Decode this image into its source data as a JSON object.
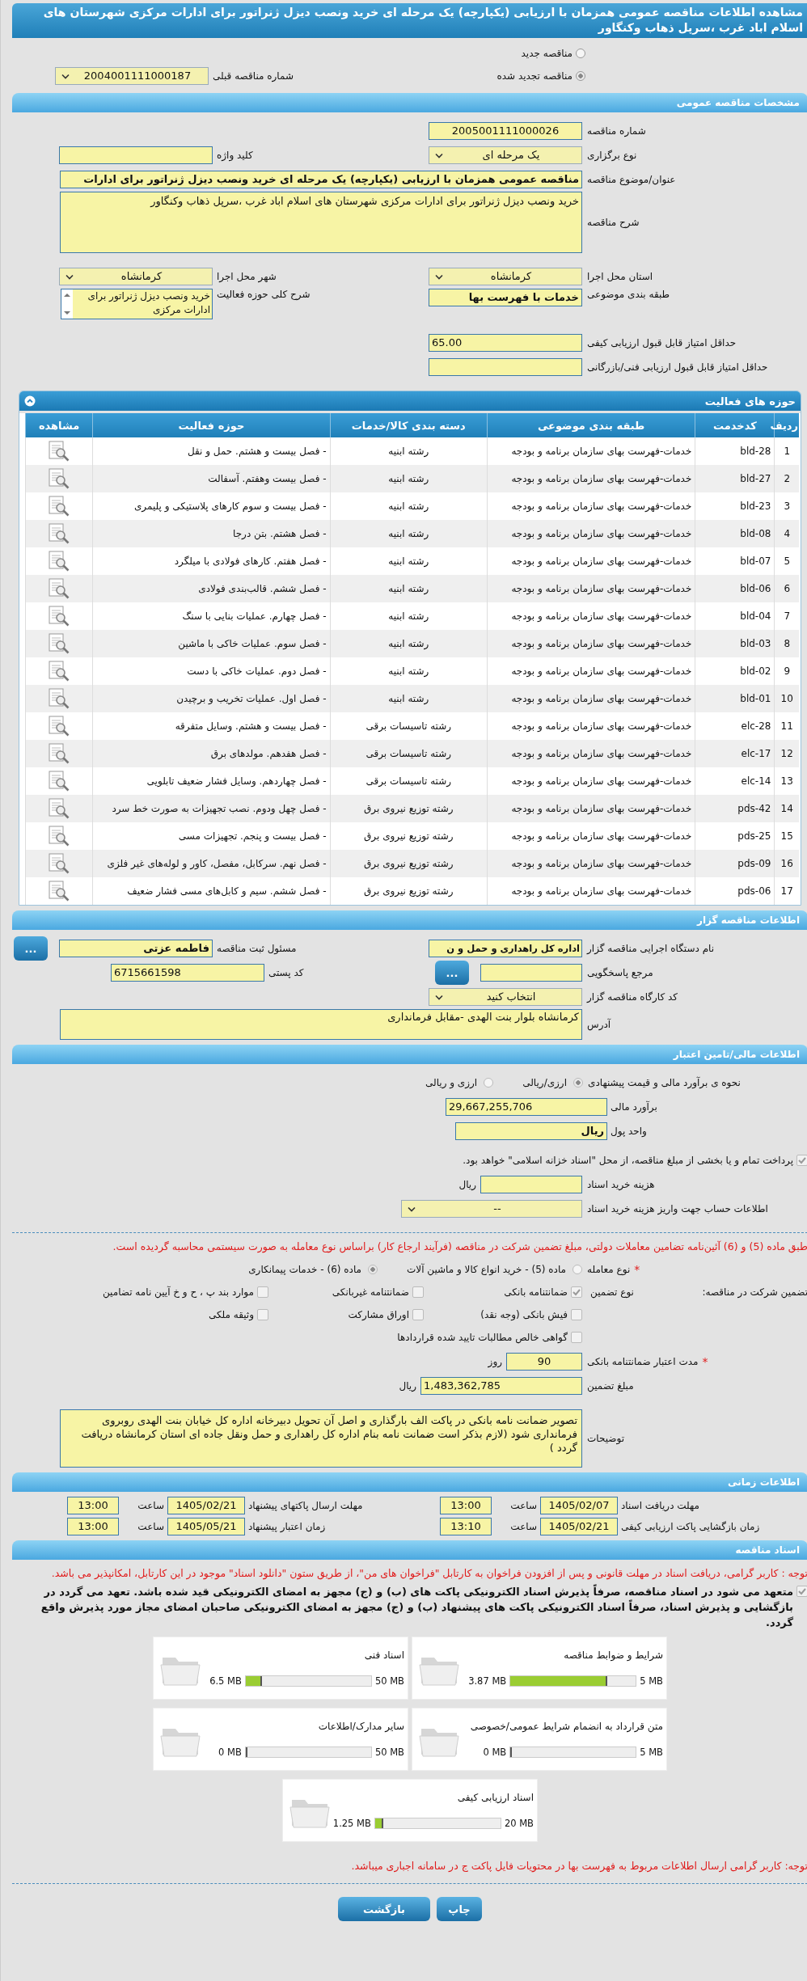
{
  "page_title": "مشاهده اطلاعات مناقصه عمومی همزمان با ارزیابی (یکپارچه) یک مرحله ای خرید ونصب دیزل ژنراتور برای ادارات مرکزی شهرستان های اسلام اباد غرب ،سرپل ذهاب وکنگاور",
  "tender_kind": [
    {
      "label": "مناقصه جدید",
      "selected": false
    },
    {
      "label": "مناقصه تجدید شده",
      "selected": true
    }
  ],
  "previous_tender": {
    "label": "شماره مناقصه قبلی",
    "value": "2004001111000187"
  },
  "general": {
    "title": "مشخصات مناقصه عمومی",
    "tender_number": {
      "label": "شماره مناقصه",
      "value": "2005001111000026"
    },
    "holding_type": {
      "label": "نوع برگزاری",
      "value": "یک مرحله ای"
    },
    "keyword": {
      "label": "کلید واژه"
    },
    "subject": {
      "label": "عنوان/موضوع مناقصه",
      "value": "مناقصه عمومی همزمان با ارزیابی (یکپارچه) یک مرحله ای خرید ونصب دیزل ژنراتور برای ادارات"
    },
    "description": {
      "label": "شرح مناقصه",
      "value": "خرید ونصب دیزل ژنراتور برای ادارات مرکزی شهرستان های اسلام اباد غرب ،سرپل ذهاب وکنگاور"
    },
    "province": {
      "label": "استان محل اجرا",
      "value": "کرمانشاه"
    },
    "city": {
      "label": "شهر محل اجرا",
      "value": "کرمانشاه"
    },
    "category": {
      "label": "طبقه بندی موضوعی",
      "value": "خدمات با فهرست بها"
    },
    "activity_summary": {
      "label": "شرح کلی حوزه فعالیت",
      "value": "خرید ونصب دیزل ژنراتور برای ادارات مرکزی"
    },
    "min_quality_score": {
      "label": "حداقل امتیاز قابل قبول ارزیابی کیفی",
      "value": "65.00"
    },
    "min_technical_score": {
      "label": "حداقل امتیاز قابل قبول ارزیابی فنی/بازرگانی"
    }
  },
  "activities": {
    "title": "حوزه های فعالیت",
    "columns": [
      "ردیف",
      "کدخدمت",
      "طبقه بندی موضوعی",
      "دسته بندی کالا/خدمات",
      "حوزه فعالیت",
      "مشاهده"
    ],
    "rows": [
      {
        "index": "1",
        "code": "bld-28",
        "category": "خدمات-فهرست بهای سازمان برنامه و بودجه",
        "group": "رشته ابنیه",
        "activity": "- فصل بیست و هشتم. حمل و نقل"
      },
      {
        "index": "2",
        "code": "bld-27",
        "category": "خدمات-فهرست بهای سازمان برنامه و بودجه",
        "group": "رشته ابنیه",
        "activity": "- فصل بیست وهفتم. آسفالت"
      },
      {
        "index": "3",
        "code": "bld-23",
        "category": "خدمات-فهرست بهای سازمان برنامه و بودجه",
        "group": "رشته ابنیه",
        "activity": "- فصل بیست و سوم کارهای پلاستیکی و پلیمری"
      },
      {
        "index": "4",
        "code": "bld-08",
        "category": "خدمات-فهرست بهای سازمان برنامه و بودجه",
        "group": "رشته ابنیه",
        "activity": "- فصل هشتم. بتن درجا"
      },
      {
        "index": "5",
        "code": "bld-07",
        "category": "خدمات-فهرست بهای سازمان برنامه و بودجه",
        "group": "رشته ابنیه",
        "activity": "- فصل هفتم. کارهای فولادی با میلگرد"
      },
      {
        "index": "6",
        "code": "bld-06",
        "category": "خدمات-فهرست بهای سازمان برنامه و بودجه",
        "group": "رشته ابنیه",
        "activity": "- فصل ششم. قالب‌بندی فولادی"
      },
      {
        "index": "7",
        "code": "bld-04",
        "category": "خدمات-فهرست بهای سازمان برنامه و بودجه",
        "group": "رشته ابنیه",
        "activity": "- فصل چهارم. عملیات بنایی با سنگ"
      },
      {
        "index": "8",
        "code": "bld-03",
        "category": "خدمات-فهرست بهای سازمان برنامه و بودجه",
        "group": "رشته ابنیه",
        "activity": "- فصل سوم. عملیات خاکی با ماشین"
      },
      {
        "index": "9",
        "code": "bld-02",
        "category": "خدمات-فهرست بهای سازمان برنامه و بودجه",
        "group": "رشته ابنیه",
        "activity": "- فصل دوم. عملیات خاکی با دست"
      },
      {
        "index": "10",
        "code": "bld-01",
        "category": "خدمات-فهرست بهای سازمان برنامه و بودجه",
        "group": "رشته ابنیه",
        "activity": "- فصل اول. عملیات تخریب و برچیدن"
      },
      {
        "index": "11",
        "code": "elc-28",
        "category": "خدمات-فهرست بهای سازمان برنامه و بودجه",
        "group": "رشته تاسیسات برقی",
        "activity": "- فصل بیست و هشتم. وسایل متفرقه"
      },
      {
        "index": "12",
        "code": "elc-17",
        "category": "خدمات-فهرست بهای سازمان برنامه و بودجه",
        "group": "رشته تاسیسات برقی",
        "activity": "- فصل هفدهم. مولدهای برق"
      },
      {
        "index": "13",
        "code": "elc-14",
        "category": "خدمات-فهرست بهای سازمان برنامه و بودجه",
        "group": "رشته تاسیسات برقی",
        "activity": "- فصل چهاردهم. وسایل فشار ضعیف تابلویی"
      },
      {
        "index": "14",
        "code": "pds-42",
        "category": "خدمات-فهرست بهای سازمان برنامه و بودجه",
        "group": "رشته توزیع نیروی برق",
        "activity": "- فصل چهل ودوم. نصب تجهیزات به صورت خط سرد"
      },
      {
        "index": "15",
        "code": "pds-25",
        "category": "خدمات-فهرست بهای سازمان برنامه و بودجه",
        "group": "رشته توزیع نیروی برق",
        "activity": "- فصل بیست و پنجم. تجهیزات مسی"
      },
      {
        "index": "16",
        "code": "pds-09",
        "category": "خدمات-فهرست بهای سازمان برنامه و بودجه",
        "group": "رشته توزیع نیروی برق",
        "activity": "- فصل نهم. سرکابل، مفصل، کاور و لوله‌های غیر فلزی"
      },
      {
        "index": "17",
        "code": "pds-06",
        "category": "خدمات-فهرست بهای سازمان برنامه و بودجه",
        "group": "رشته توزیع نیروی برق",
        "activity": "- فصل ششم. سیم و کابل‌های مسی فشار ضعیف"
      }
    ]
  },
  "employer": {
    "title": "اطلاعات مناقصه گزار",
    "agency": {
      "label": "نام دستگاه اجرایی مناقصه گزار",
      "value": "اداره کل راهداری و حمل و ن"
    },
    "registrar": {
      "label": "مسئول ثبت مناقصه",
      "value": "فاطمه  عزتی",
      "button": "..."
    },
    "reference": {
      "label": "مرجع پاسخگویی",
      "button": "..."
    },
    "postal_code": {
      "label": "کد پستی",
      "value": "6715661598"
    },
    "workshop_code": {
      "label": "کد کارگاه مناقصه گزار",
      "value": "انتخاب کنید"
    },
    "address": {
      "label": "آدرس",
      "value": "کرمانشاه بلوار بنت الهدی -مقابل فرمانداری"
    }
  },
  "finance": {
    "title": "اطلاعات مالی/تامین اعتبار",
    "estimate_method": {
      "label": "نحوه ی برآورد مالی و قیمت پیشنهادی",
      "options": [
        {
          "label": "ارزی/ریالی",
          "selected": true
        },
        {
          "label": "ارزی و ریالی",
          "selected": false
        }
      ]
    },
    "estimate": {
      "label": "برآورد مالی",
      "value": "29,667,255,706"
    },
    "currency": {
      "label": "واحد پول",
      "value": "ریال"
    },
    "treasury": {
      "label": "پرداخت تمام و یا بخشی از مبلغ مناقصه، از محل \"اسناد خزانه اسلامی\" خواهد بود.",
      "checked": true
    },
    "doc_fee": {
      "label": "هزینه خرید اسناد",
      "unit": "ریال"
    },
    "fee_account": {
      "label": "اطلاعات حساب جهت واریز هزینه خرید اسناد",
      "value": "--"
    }
  },
  "guarantee": {
    "notice": "طبق ماده (5) و (6) آئین‌نامه تضامین معاملات دولتی، مبلغ تضمین شرکت در مناقصه (فرآیند ارجاع کار) براساس نوع معامله به صورت سیستمی محاسبه گردیده است.",
    "deal_type": {
      "mark": "*",
      "label": "نوع معامله",
      "options": [
        {
          "label": "ماده (5) - خرید انواع کالا و ماشین آلات",
          "selected": false
        },
        {
          "label": "ماده (6) - خدمات پیمانکاری",
          "selected": true
        }
      ]
    },
    "participation_label": "تضمین شرکت در مناقصه:",
    "type_label": "نوع تضمین",
    "types": [
      {
        "label": "ضمانتنامه بانکی",
        "checked": true
      },
      {
        "label": "ضمانتنامه غیربانکی",
        "checked": false
      },
      {
        "label": "موارد بند پ ، ح و خ آیین نامه تضامین",
        "checked": false
      },
      {
        "label": "فیش بانکی (وجه نقد)",
        "checked": false
      },
      {
        "label": "اوراق مشارکت",
        "checked": false
      },
      {
        "label": "وثیقه ملکی",
        "checked": false
      },
      {
        "label": "گواهی خالص مطالبات تایید شده قراردادها",
        "checked": false
      }
    ],
    "validity": {
      "mark": "*",
      "label": "مدت اعتبار ضمانتنامه بانکی",
      "value": "90",
      "unit": "روز"
    },
    "amount": {
      "label": "مبلغ تضمین",
      "value": "1,483,362,785",
      "unit": "ریال"
    },
    "notes": {
      "label": "توضیحات",
      "value": "تصویر ضمانت نامه بانکی در پاکت الف بارگذاری و اصل آن تحویل دبیرخانه اداره کل خیابان بنت الهدی روبروی فرمانداری شود  (لازم بذکر است ضمانت نامه بنام اداره کل راهداری و حمل ونقل جاده ای استان کرمانشاه دریافت گردد )"
    }
  },
  "schedule": {
    "title": "اطلاعات زمانی",
    "items": [
      {
        "label": "مهلت دریافت اسناد",
        "date": "1405/02/07",
        "time_label": "ساعت",
        "time": "13:00"
      },
      {
        "label": "مهلت ارسال پاکتهای پیشنهاد",
        "date": "1405/02/21",
        "time_label": "ساعت",
        "time": "13:00"
      },
      {
        "label": "زمان بازگشایی پاکت ارزیابی کیفی",
        "date": "1405/02/21",
        "time_label": "ساعت",
        "time": "13:10"
      },
      {
        "label": "زمان اعتبار پیشنهاد",
        "date": "1405/05/21",
        "time_label": "ساعت",
        "time": "13:00"
      }
    ]
  },
  "documents": {
    "title": "اسناد مناقصه",
    "notice": "توجه : کاربر گرامی، دریافت اسناد در مهلت قانونی و پس از افزودن فراخوان به کارتابل \"فراخوان های من\"، از طریق ستون \"دانلود اسناد\" موجود در این کارتابل، امکانپذیر می باشد.",
    "commitment": {
      "text": "متعهد می شود در اسناد مناقصه، صرفاً پذیرش اسناد الکترونیکی پاکت های (ب) و (ج) مجهز به امضای الکترونیکی قید شده باشد. تعهد می گردد در بازگشایی و پذیرش اسناد، صرفاً اسناد الکترونیکی پاکت های پیشنهاد (ب) و (ج) مجهز به امضای الکترونیکی صاحبان امضای مجاز مورد پذیرش واقع گردد.",
      "checked": true
    },
    "files": [
      {
        "name": "شرایط و ضوابط مناقصه",
        "max": "5 MB",
        "used": "3.87 MB",
        "level": 0.774
      },
      {
        "name": "اسناد فنی",
        "max": "50 MB",
        "used": "6.5 MB",
        "level": 0.13
      },
      {
        "name": "متن قرارداد به انضمام شرایط عمومی/خصوصی",
        "max": "5 MB",
        "used": "0 MB",
        "level": 0
      },
      {
        "name": "سایر مدارک/اطلاعات",
        "max": "50 MB",
        "used": "0 MB",
        "level": 0
      },
      {
        "name": "اسناد ارزیابی کیفی",
        "max": "20 MB",
        "used": "1.25 MB",
        "level": 0.0625
      }
    ],
    "footer_notice": "توجه: کاربر گرامی ارسال اطلاعات مربوط به فهرست بها در محتویات فایل پاکت ج در سامانه اجباری میباشد."
  },
  "actions": [
    {
      "label": "چاپ"
    },
    {
      "label": "بازگشت"
    }
  ]
}
